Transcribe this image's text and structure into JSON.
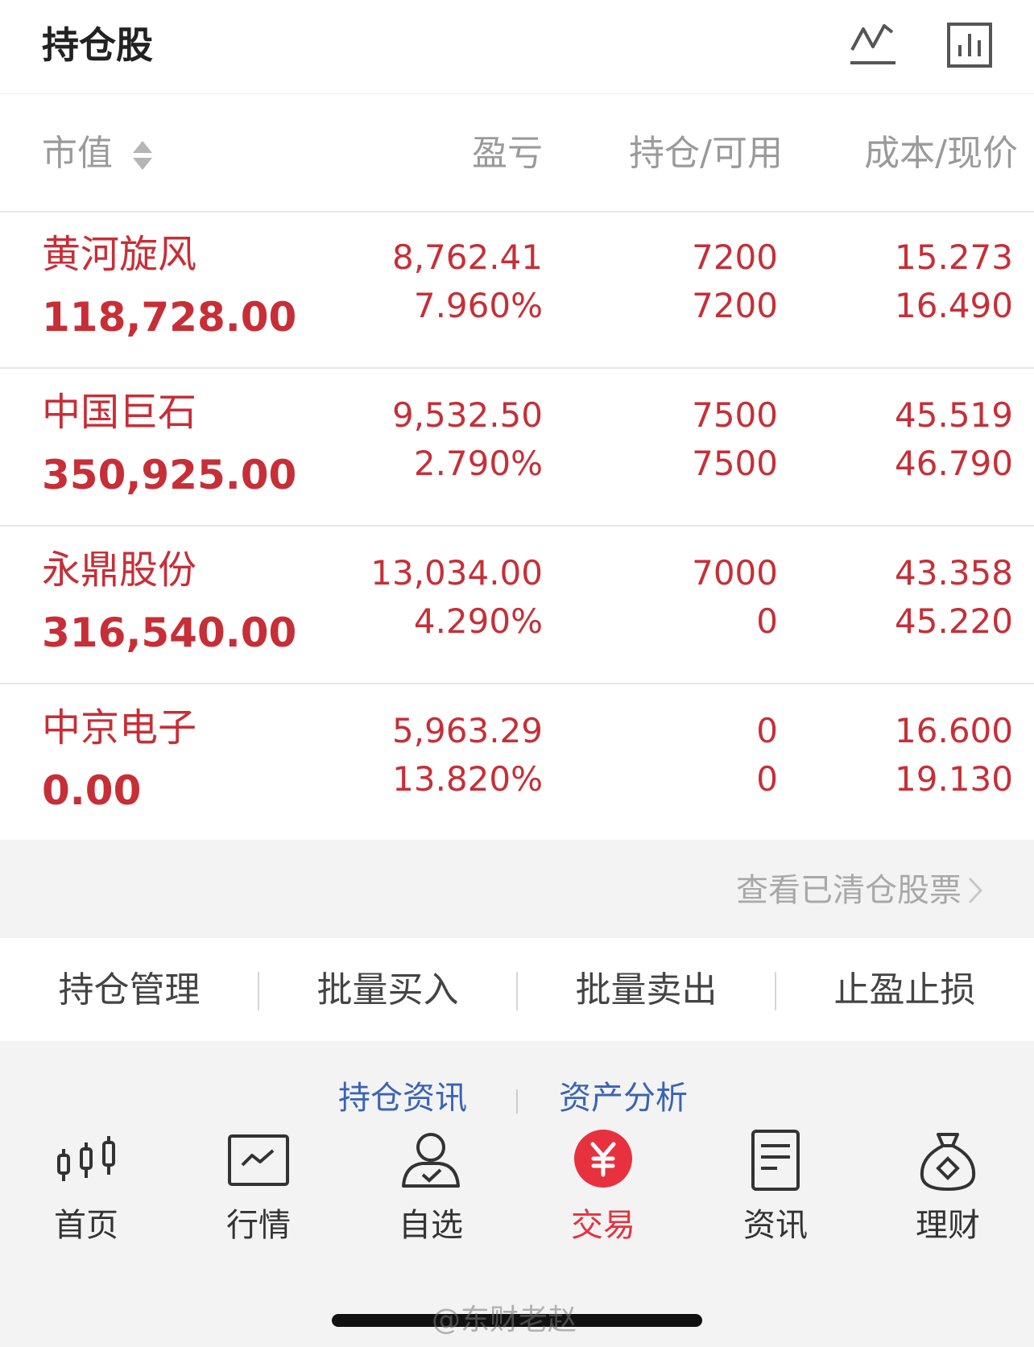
{
  "header": {
    "title": "持仓股",
    "icons": [
      "line-chart-icon",
      "bar-chart-icon"
    ]
  },
  "columns": {
    "market_value": "市值",
    "pnl": "盈亏",
    "position": "持仓/可用",
    "cost_price": "成本/现价"
  },
  "holdings": [
    {
      "name": "黄河旋风",
      "market_value": "118,728.00",
      "pnl": "8,762.41",
      "pnl_pct": "7.960%",
      "position": "7200",
      "available": "7200",
      "cost": "15.273",
      "price": "16.490"
    },
    {
      "name": "中国巨石",
      "market_value": "350,925.00",
      "pnl": "9,532.50",
      "pnl_pct": "2.790%",
      "position": "7500",
      "available": "7500",
      "cost": "45.519",
      "price": "46.790"
    },
    {
      "name": "永鼎股份",
      "market_value": "316,540.00",
      "pnl": "13,034.00",
      "pnl_pct": "4.290%",
      "position": "7000",
      "available": "0",
      "cost": "43.358",
      "price": "45.220"
    },
    {
      "name": "中京电子",
      "market_value": "0.00",
      "pnl": "5,963.29",
      "pnl_pct": "13.820%",
      "position": "0",
      "available": "0",
      "cost": "16.600",
      "price": "19.130"
    }
  ],
  "cleared_link": "查看已清仓股票",
  "actions": [
    "持仓管理",
    "批量买入",
    "批量卖出",
    "止盈止损"
  ],
  "info_links": [
    "持仓资讯",
    "资产分析"
  ],
  "tabbar": [
    {
      "label": "首页",
      "icon": "candlestick-icon"
    },
    {
      "label": "行情",
      "icon": "market-chart-icon"
    },
    {
      "label": "自选",
      "icon": "user-check-icon"
    },
    {
      "label": "交易",
      "icon": "yen-icon",
      "active": true
    },
    {
      "label": "资讯",
      "icon": "document-icon"
    },
    {
      "label": "理财",
      "icon": "money-bag-icon"
    }
  ],
  "watermark": "@东财老赵",
  "colors": {
    "rise": "#c62f37",
    "accent": "#e8313e",
    "link": "#3a63b5"
  }
}
